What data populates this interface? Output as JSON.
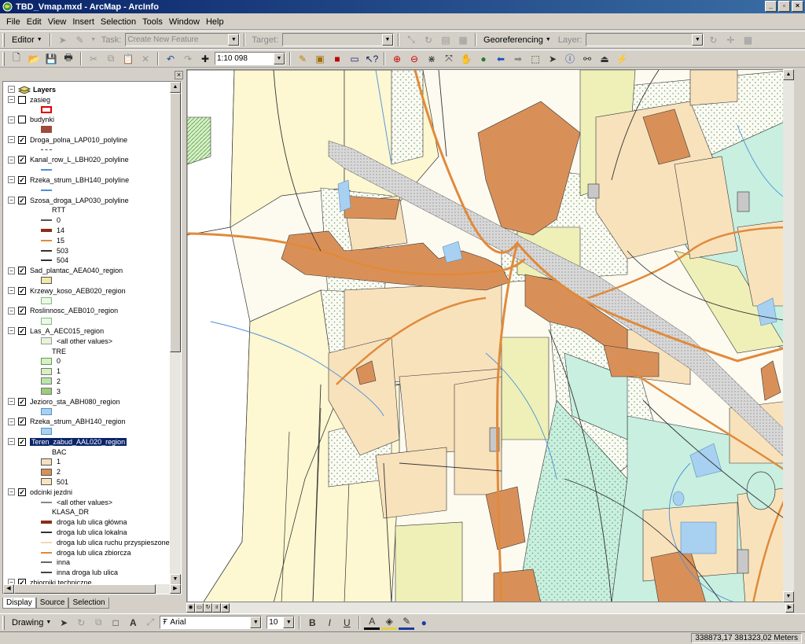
{
  "window": {
    "title": "TBD_Vmap.mxd - ArcMap - ArcInfo"
  },
  "menu": [
    "File",
    "Edit",
    "View",
    "Insert",
    "Selection",
    "Tools",
    "Window",
    "Help"
  ],
  "editor_toolbar": {
    "editor_label": "Editor",
    "task_label": "Task:",
    "task_value": "Create New Feature",
    "target_label": "Target:",
    "georef_label": "Georeferencing",
    "layer_label": "Layer:"
  },
  "standard_toolbar": {
    "scale": "1:10 098"
  },
  "toc": {
    "root": "Layers",
    "rows": [
      {
        "type": "layer",
        "label": "zasieg",
        "checked": false
      },
      {
        "type": "swatch",
        "fill": "#ffffff",
        "stroke": "#e00000"
      },
      {
        "type": "layer",
        "label": "budynki",
        "checked": false
      },
      {
        "type": "swatch",
        "fill": "#9e4a3c",
        "stroke": "#9e4a3c"
      },
      {
        "type": "layer",
        "label": "Droga_polna_LAP010_polyline",
        "checked": true
      },
      {
        "type": "line",
        "color": "#444444",
        "dash": true
      },
      {
        "type": "layer",
        "label": "Kanal_row_L_LBH020_polyline",
        "checked": true
      },
      {
        "type": "line",
        "color": "#4a90d9"
      },
      {
        "type": "layer",
        "label": "Rzeka_strum_LBH140_polyline",
        "checked": true
      },
      {
        "type": "line",
        "color": "#4a90d9"
      },
      {
        "type": "layer",
        "label": "Szosa_droga_LAP030_polyline",
        "checked": true
      },
      {
        "type": "text",
        "label": "RTT"
      },
      {
        "type": "line",
        "color": "#555555",
        "label": "0"
      },
      {
        "type": "line",
        "color": "#8b2c1a",
        "label": "14",
        "thick": true
      },
      {
        "type": "line",
        "color": "#e08a3c",
        "label": "15"
      },
      {
        "type": "line",
        "color": "#333333",
        "label": "503"
      },
      {
        "type": "line",
        "color": "#333333",
        "label": "504"
      },
      {
        "type": "layer",
        "label": "Sad_plantac_AEA040_region",
        "checked": true
      },
      {
        "type": "swatch",
        "fill": "#f3e9a6",
        "stroke": "#555555"
      },
      {
        "type": "layer",
        "label": "Krzewy_koso_AEB020_region",
        "checked": true
      },
      {
        "type": "swatch",
        "fill": "#eef6e8",
        "stroke": "#7ac07a"
      },
      {
        "type": "layer",
        "label": "Roslinnosc_AEB010_region",
        "checked": true
      },
      {
        "type": "swatch",
        "fill": "#eef6e8",
        "stroke": "#7ac07a"
      },
      {
        "type": "layer",
        "label": "Las_A_AEC015_region",
        "checked": true
      },
      {
        "type": "swatch",
        "fill": "#e8f4d8",
        "stroke": "#999999",
        "label": "<all other values>"
      },
      {
        "type": "text",
        "label": "TRE"
      },
      {
        "type": "swatch",
        "fill": "#d8efc8",
        "stroke": "#5aa04a",
        "label": "0"
      },
      {
        "type": "swatch",
        "fill": "#d6f0c0",
        "stroke": "#777777",
        "label": "1"
      },
      {
        "type": "swatch",
        "fill": "#b8e6a8",
        "stroke": "#777777",
        "label": "2"
      },
      {
        "type": "swatch",
        "fill": "#9ccd78",
        "stroke": "#777777",
        "label": "3"
      },
      {
        "type": "layer",
        "label": "Jezioro_sta_ABH080_region",
        "checked": true
      },
      {
        "type": "swatch",
        "fill": "#a8d0f0",
        "stroke": "#5a8fc0"
      },
      {
        "type": "layer",
        "label": "Rzeka_strum_ABH140_region",
        "checked": true
      },
      {
        "type": "swatch",
        "fill": "#a8d0f0",
        "stroke": "#5a8fc0"
      },
      {
        "type": "layer",
        "label": "Teren_zabud_AAL020_region",
        "checked": true,
        "selected": true
      },
      {
        "type": "text",
        "label": "BAC"
      },
      {
        "type": "swatch",
        "fill": "#f7e0c0",
        "stroke": "#555555",
        "label": "1"
      },
      {
        "type": "swatch",
        "fill": "#d99058",
        "stroke": "#555555",
        "label": "2"
      },
      {
        "type": "swatch",
        "fill": "#f8e4c0",
        "stroke": "#555555",
        "label": "501"
      },
      {
        "type": "layer",
        "label": "odcinki jezdni",
        "checked": true
      },
      {
        "type": "line",
        "color": "#888888",
        "label": "<all other values>"
      },
      {
        "type": "text",
        "label": "KLASA_DR"
      },
      {
        "type": "line",
        "color": "#8b2c1a",
        "label": "droga lub ulica główna",
        "thick": true
      },
      {
        "type": "line",
        "color": "#333333",
        "label": "droga lub ulica lokalna"
      },
      {
        "type": "line",
        "color": "#f0d8b0",
        "label": "droga lub ulica ruchu przyspieszonego"
      },
      {
        "type": "line",
        "color": "#e08a3c",
        "label": "droga lub ulica zbiorcza"
      },
      {
        "type": "line",
        "color": "#666666",
        "label": "inna"
      },
      {
        "type": "line",
        "color": "#444444",
        "label": "inna droga lub ulica"
      },
      {
        "type": "layer",
        "label": "zbiorniki techniczne",
        "checked": true
      }
    ]
  },
  "toc_tabs": [
    "Display",
    "Source",
    "Selection"
  ],
  "drawing_toolbar": {
    "drawing_label": "Drawing",
    "font": "Arial",
    "size": "10"
  },
  "status": {
    "coords": "338873,17  381323,02 Meters"
  }
}
